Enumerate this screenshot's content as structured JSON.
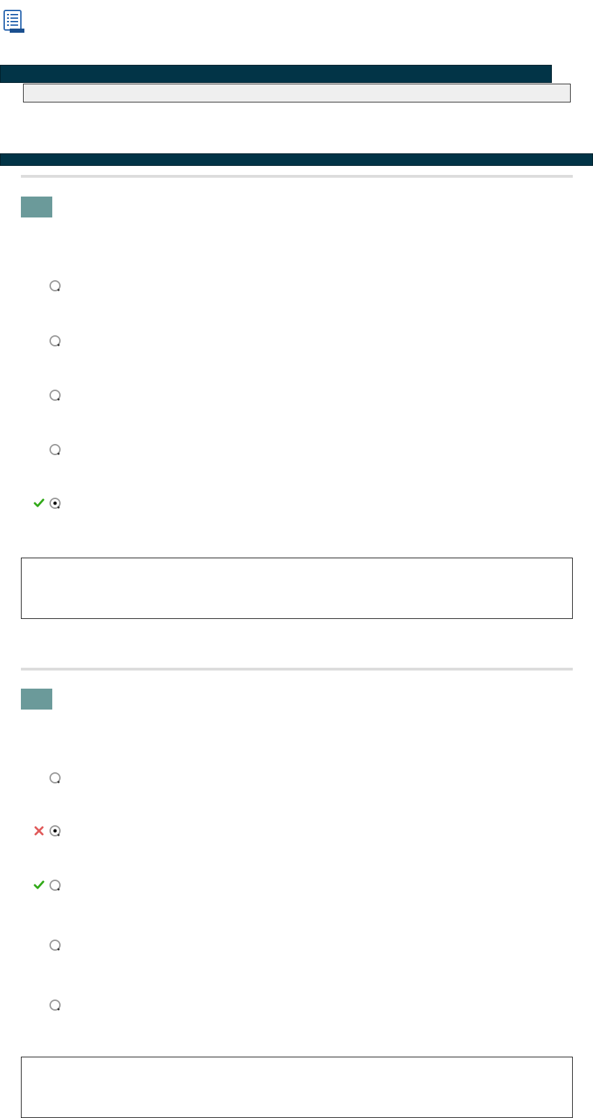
{
  "icons": {
    "document": "document-list-icon",
    "radio_unchecked": "radio-unchecked-icon",
    "radio_checked": "radio-checked-icon",
    "correct": "check-icon",
    "incorrect": "cross-icon"
  },
  "colors": {
    "header_bar": "#023447",
    "subheader_bar": "#efefef",
    "question_number": "#6b9a9a",
    "separator": "#dcdcdc",
    "correct": "#33aa1a",
    "incorrect": "#e05a5a"
  },
  "header": {
    "title": "",
    "subtitle": "",
    "section": ""
  },
  "questions": [
    {
      "number": "",
      "options": [
        {
          "label": "",
          "selected": false,
          "mark": ""
        },
        {
          "label": "",
          "selected": false,
          "mark": ""
        },
        {
          "label": "",
          "selected": false,
          "mark": ""
        },
        {
          "label": "",
          "selected": false,
          "mark": ""
        },
        {
          "label": "",
          "selected": true,
          "mark": "correct"
        }
      ],
      "feedback": ""
    },
    {
      "number": "",
      "options": [
        {
          "label": "",
          "selected": false,
          "mark": ""
        },
        {
          "label": "",
          "selected": true,
          "mark": "incorrect"
        },
        {
          "label": "",
          "selected": false,
          "mark": "correct"
        },
        {
          "label": "",
          "selected": false,
          "mark": ""
        },
        {
          "label": "",
          "selected": false,
          "mark": ""
        }
      ],
      "feedback": ""
    }
  ]
}
